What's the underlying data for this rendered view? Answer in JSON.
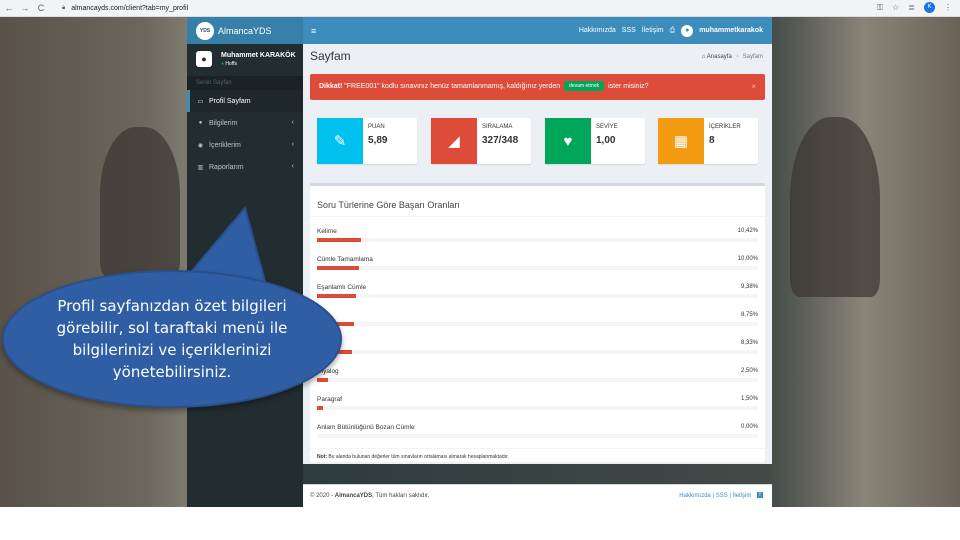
{
  "browser": {
    "url": "almancayds.com/client?tab=my_profil",
    "back": "←",
    "forward": "→",
    "reload": "C",
    "profile_initial": "K"
  },
  "header": {
    "logo_badge": "YDS",
    "logo_text": "AlmancaYDS",
    "menu_toggle": "≡",
    "links": [
      "Hakkımızda",
      "SSS",
      "İletişim"
    ],
    "username": "muhammetkarakok"
  },
  "sidebar": {
    "user_name": "Muhammet KARAKÖK",
    "user_status": "Hoffs",
    "section_header": "Senin Sayfan",
    "items": [
      {
        "label": "Profil Sayfam",
        "icon": "▭"
      },
      {
        "label": "Bilgilerim",
        "icon": "●"
      },
      {
        "label": "İçeriklerim",
        "icon": "◉"
      },
      {
        "label": "Raporlarım",
        "icon": "▥"
      }
    ],
    "chevron": "‹"
  },
  "content": {
    "page_title": "Sayfam",
    "breadcrumb_home": "Anasayfa",
    "breadcrumb_sep": ">",
    "breadcrumb_current": "Sayfam"
  },
  "alert": {
    "strong": "Dikkat!",
    "text_before": " \"FREE001\" kodlu sınavınız henüz tamamlanmamış, kaldığınız yerden",
    "button_label": "devam etmek",
    "text_after": "ister misiniz?",
    "close": "×"
  },
  "info_boxes": [
    {
      "label": "PUAN",
      "value": "5,89",
      "color": "#00c0ef",
      "icon": "✎"
    },
    {
      "label": "SIRALAMA",
      "value": "327/348",
      "color": "#dd4b39",
      "icon": "◢"
    },
    {
      "label": "SEVİYE",
      "value": "1,00",
      "color": "#00a65a",
      "icon": "♥"
    },
    {
      "label": "İÇERİKLER",
      "value": "8",
      "color": "#f39c12",
      "icon": "▦"
    }
  ],
  "success_box": {
    "title": "Soru Türlerine Göre Başarı Oranları",
    "rows": [
      {
        "label": "Kelime",
        "percent_label": "10,42%",
        "percent": 10.42
      },
      {
        "label": "Cümle Tamamlama",
        "percent_label": "10,00%",
        "percent": 10.0
      },
      {
        "label": "Eşanlamlı Cümle",
        "percent_label": "9,38%",
        "percent": 9.38
      },
      {
        "label": "",
        "percent_label": "8,75%",
        "percent": 8.75
      },
      {
        "label": "",
        "percent_label": "8,33%",
        "percent": 8.33
      },
      {
        "label": "Diyalog",
        "percent_label": "2,50%",
        "percent": 2.5
      },
      {
        "label": "Paragraf",
        "percent_label": "1,50%",
        "percent": 1.5
      },
      {
        "label": "Anlam Bütünlüğünü Bozan Cümle",
        "percent_label": "0,00%",
        "percent": 0.0
      }
    ],
    "note_strong": "Not:",
    "note_text": " Bu alanda bulunan değerler tüm sınavların ortalaması alınarak hesaplanmaktadır."
  },
  "footer": {
    "copyright_prefix": "© 2020 - ",
    "brand": "AlmancaYDS",
    "copyright_suffix": ", Tüm hakları saklıdır.",
    "links": "Hakkımızda | SSS | İletişim",
    "fb": "f"
  },
  "callout": {
    "text": "Profil sayfanızdan özet bilgileri görebilir, sol taraftaki menü ile bilgilerinizi ve içeriklerinizi yönetebilirsiniz.",
    "color": "#2f5ea5"
  }
}
